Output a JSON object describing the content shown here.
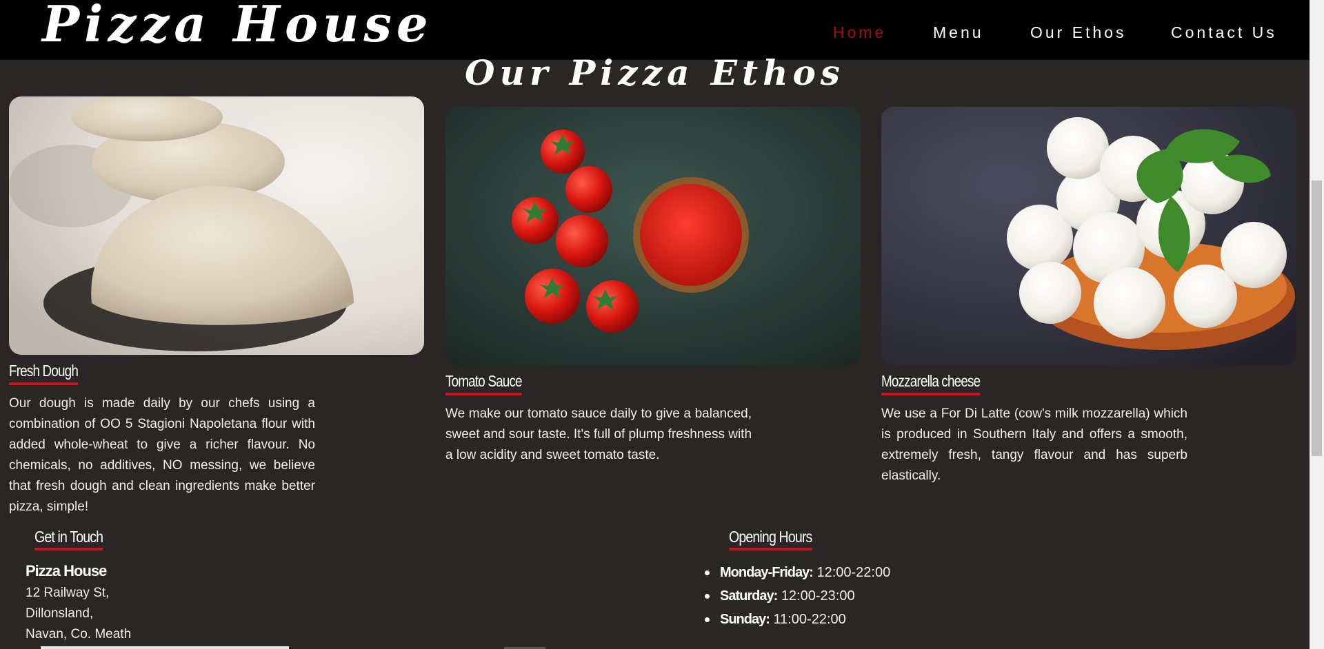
{
  "header": {
    "logo": "Pizza House",
    "nav": [
      {
        "label": "Home",
        "active": true
      },
      {
        "label": "Menu",
        "active": false
      },
      {
        "label": "Our Ethos",
        "active": false
      },
      {
        "label": "Contact Us",
        "active": false
      }
    ]
  },
  "main": {
    "title": "Our Pizza Ethos",
    "cards": [
      {
        "title": "Fresh Dough",
        "image": "pizza-dough-balls",
        "text": "Our dough is made daily by our chefs using a combination of OO 5 Stagioni Napoletana flour with added whole-wheat to give a richer flavour. No chemicals, no additives, NO messing, we believe that fresh dough and clean ingredients make better pizza, simple!"
      },
      {
        "title": "Tomato Sauce",
        "image": "tomatoes-and-sauce-bowl",
        "text": "We make our tomato sauce daily to give a balanced, sweet and sour taste. It's full of plump freshness with a low acidity and sweet tomato taste."
      },
      {
        "title": "Mozzarella cheese",
        "image": "mozzarella-balls-bowl",
        "text": "We use a For Di Latte (cow's milk mozzarella) which is produced in Southern Italy and offers a smooth, extremely fresh, tangy flavour and has superb elastically."
      }
    ]
  },
  "footer": {
    "contact": {
      "heading": "Get in Touch",
      "name": "Pizza House",
      "lines": [
        "12 Railway St,",
        "Dillonsland,",
        "Navan, Co. Meath"
      ]
    },
    "hours": {
      "heading": "Opening Hours",
      "items": [
        {
          "day": "Monday-Friday:",
          "time": "12:00-22:00"
        },
        {
          "day": "Saturday:",
          "time": "12:00-23:00"
        },
        {
          "day": "Sunday:",
          "time": "11:00-22:00"
        }
      ]
    }
  },
  "colors": {
    "background": "#2b2626",
    "header": "#000000",
    "accent": "#d0121b",
    "active_nav": "#a50d0d"
  }
}
